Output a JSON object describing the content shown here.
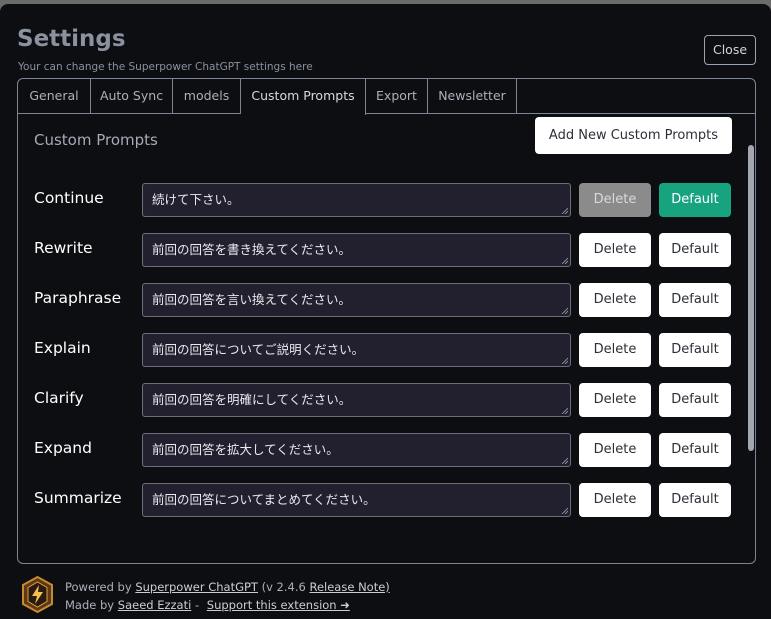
{
  "header": {
    "title": "Settings",
    "subtitle": "Your can change the Superpower ChatGPT settings here",
    "close_label": "Close"
  },
  "tabs": [
    {
      "label": "General"
    },
    {
      "label": "Auto Sync"
    },
    {
      "label": "models"
    },
    {
      "label": "Custom Prompts",
      "active": true
    },
    {
      "label": "Export"
    },
    {
      "label": "Newsletter"
    }
  ],
  "section": {
    "title": "Custom Prompts",
    "add_label": "Add New Custom Prompts"
  },
  "prompts": [
    {
      "label": "Continue",
      "value": "続けて下さい。",
      "delete_label": "Delete",
      "default_label": "Default",
      "is_default": true
    },
    {
      "label": "Rewrite",
      "value": "前回の回答を書き換えてください。",
      "delete_label": "Delete",
      "default_label": "Default",
      "is_default": false
    },
    {
      "label": "Paraphrase",
      "value": "前回の回答を言い換えてください。",
      "delete_label": "Delete",
      "default_label": "Default",
      "is_default": false
    },
    {
      "label": "Explain",
      "value": "前回の回答についてご説明ください。",
      "delete_label": "Delete",
      "default_label": "Default",
      "is_default": false
    },
    {
      "label": "Clarify",
      "value": "前回の回答を明確にしてください。",
      "delete_label": "Delete",
      "default_label": "Default",
      "is_default": false
    },
    {
      "label": "Expand",
      "value": "前回の回答を拡大してください。",
      "delete_label": "Delete",
      "default_label": "Default",
      "is_default": false
    },
    {
      "label": "Summarize",
      "value": "前回の回答についてまとめてください。",
      "delete_label": "Delete",
      "default_label": "Default",
      "is_default": false
    }
  ],
  "footer": {
    "powered_prefix": "Powered by",
    "product_link": "Superpower ChatGPT",
    "version": "(v 2.4.6",
    "release_link": "Release Note)",
    "made_prefix": "Made by",
    "author_link": "Saeed Ezzati",
    "separator": "-",
    "support_link": "Support this extension ➜"
  },
  "colors": {
    "background": "#0d0e11",
    "accent_green": "#16a37e",
    "input_bg": "#22202f"
  },
  "icons": [
    "superpower-logo-icon",
    "resize-grip-icon"
  ]
}
